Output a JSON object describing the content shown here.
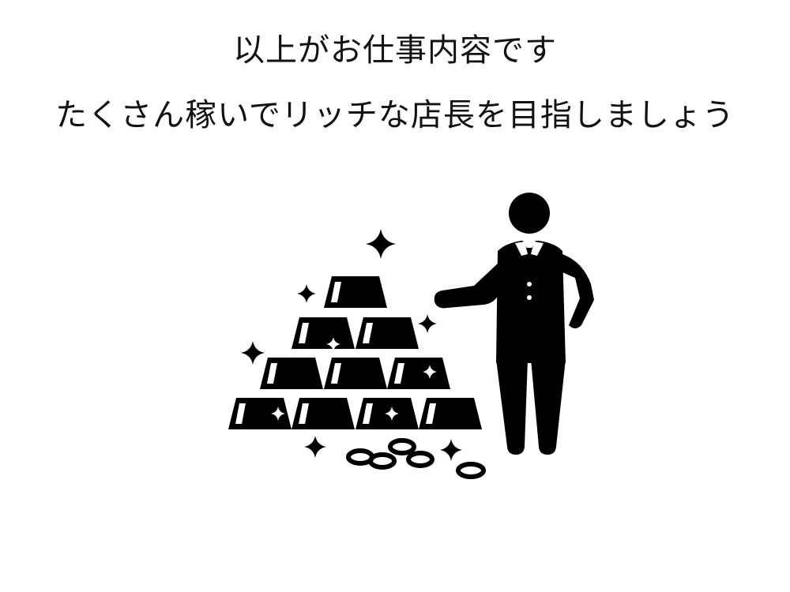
{
  "slide": {
    "heading_line1": "以上がお仕事内容です",
    "heading_line2": "たくさん稼いでリッチな店長を目指しましょう"
  },
  "illustration": {
    "description_icon": "rich-manager-with-gold-bars-icon",
    "fill_color": "#000000",
    "background_color": "#ffffff"
  }
}
